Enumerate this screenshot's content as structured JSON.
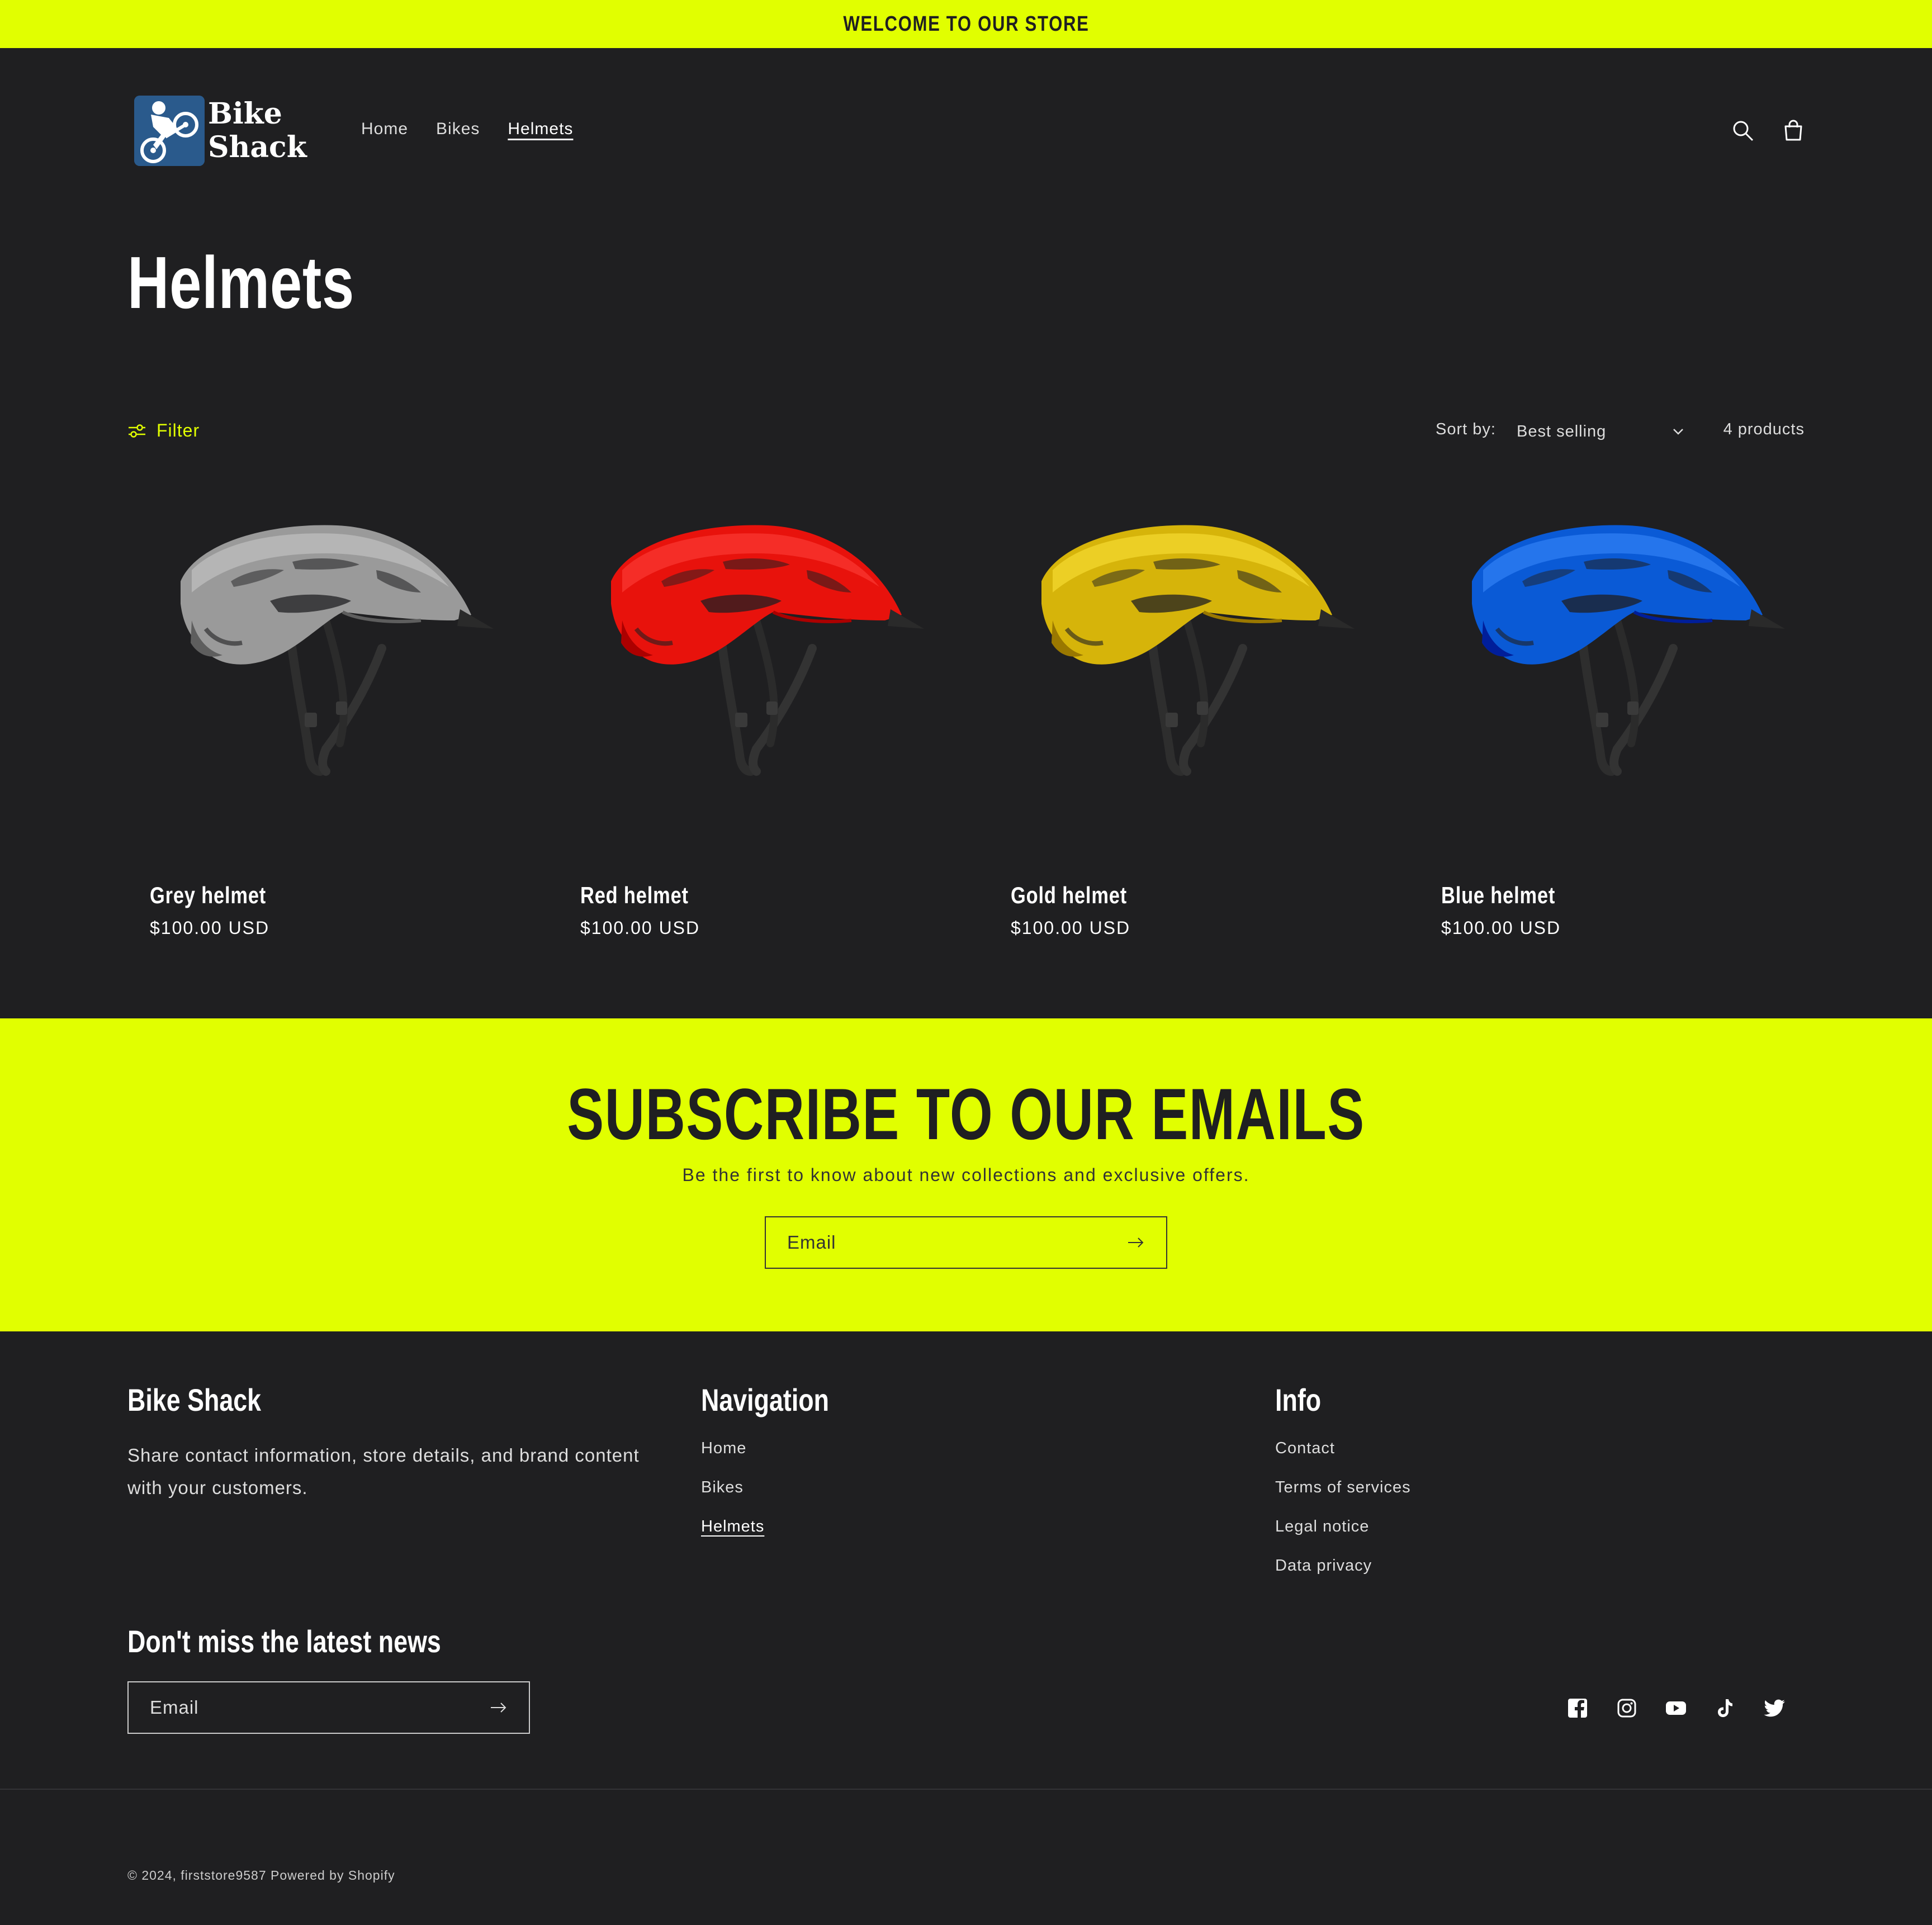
{
  "announcement": {
    "text": "WELCOME TO OUR STORE"
  },
  "header": {
    "logo": {
      "line1": "Bike",
      "line2": "Shack"
    },
    "nav": [
      {
        "label": "Home",
        "active": false
      },
      {
        "label": "Bikes",
        "active": false
      },
      {
        "label": "Helmets",
        "active": true
      }
    ],
    "icons": [
      "search-icon",
      "cart-icon"
    ]
  },
  "collection": {
    "title": "Helmets",
    "filter_label": "Filter",
    "sort_label": "Sort by:",
    "sort_value": "Best selling",
    "product_count": "4 products",
    "accent_color": "#e1ff00"
  },
  "products": [
    {
      "name": "Grey helmet",
      "price": "$100.00 USD",
      "color": "#9a9a9a"
    },
    {
      "name": "Red helmet",
      "price": "$100.00 USD",
      "color": "#e8120c"
    },
    {
      "name": "Gold helmet",
      "price": "$100.00 USD",
      "color": "#d6b40a"
    },
    {
      "name": "Blue helmet",
      "price": "$100.00 USD",
      "color": "#0a5ad6"
    }
  ],
  "subscribe": {
    "heading": "SUBSCRIBE TO OUR EMAILS",
    "text": "Be the first to know about new collections and exclusive offers.",
    "email_placeholder": "Email"
  },
  "footer": {
    "brand": {
      "heading": "Bike Shack",
      "text": "Share contact information, store details, and brand content with your customers."
    },
    "navigation": {
      "heading": "Navigation",
      "links": [
        "Home",
        "Bikes",
        "Helmets"
      ]
    },
    "info": {
      "heading": "Info",
      "links": [
        "Contact",
        "Terms of services",
        "Legal notice",
        "Data privacy"
      ]
    },
    "newsletter": {
      "heading": "Don't miss the latest news",
      "email_placeholder": "Email"
    },
    "socials": [
      "facebook-icon",
      "instagram-icon",
      "youtube-icon",
      "tiktok-icon",
      "twitter-icon"
    ],
    "copyright": "© 2024, firststore9587 Powered by Shopify"
  }
}
